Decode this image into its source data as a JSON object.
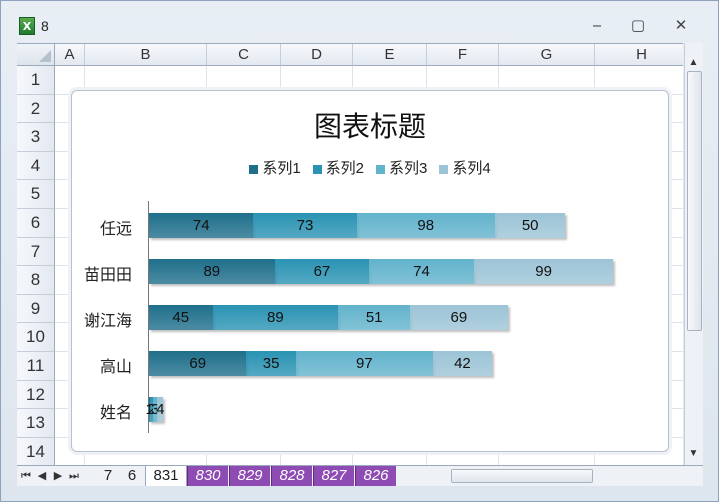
{
  "window": {
    "title": "8",
    "app_icon": "excel-icon",
    "minimize_glyph": "‒",
    "maximize_glyph": "▢",
    "close_glyph": "✕"
  },
  "columns": [
    "A",
    "B",
    "C",
    "D",
    "E",
    "F",
    "G",
    "H"
  ],
  "rows": [
    "1",
    "2",
    "3",
    "4",
    "5",
    "6",
    "7",
    "8",
    "9",
    "10",
    "11",
    "12",
    "13",
    "14"
  ],
  "sheet_tabs": [
    "7",
    "6",
    "831",
    "830",
    "829",
    "828",
    "827",
    "826"
  ],
  "active_tab": "831",
  "chart_data": {
    "type": "bar",
    "orientation": "horizontal",
    "stacked": true,
    "title": "图表标题",
    "categories": [
      "任远",
      "苗田田",
      "谢江海",
      "高山",
      "姓名"
    ],
    "series": [
      {
        "name": "系列1",
        "color": "#1f6f8b",
        "values": [
          74,
          89,
          45,
          69,
          1
        ]
      },
      {
        "name": "系列2",
        "color": "#2a93b3",
        "values": [
          73,
          67,
          89,
          35,
          2
        ]
      },
      {
        "name": "系列3",
        "color": "#62b3cc",
        "values": [
          98,
          74,
          51,
          97,
          3
        ]
      },
      {
        "name": "系列4",
        "color": "#9cc4d6",
        "values": [
          50,
          99,
          69,
          42,
          4
        ]
      }
    ],
    "legend_position": "top",
    "grid": false,
    "xlim": [
      0,
      340
    ]
  }
}
